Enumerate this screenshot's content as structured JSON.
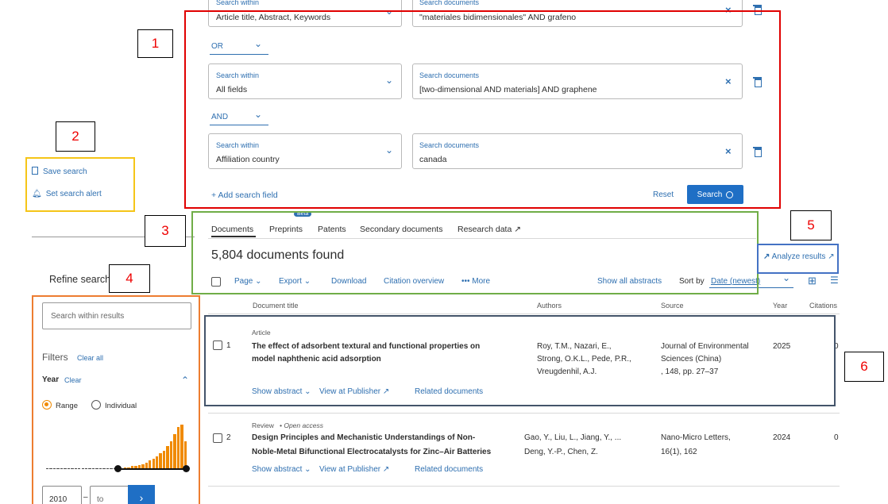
{
  "search_rows": [
    {
      "within_label": "Search within",
      "within_value": "Article title, Abstract, Keywords",
      "doc_label": "Search documents",
      "doc_value": "\"materiales bidimensionales\" AND grafeno"
    },
    {
      "within_label": "Search within",
      "within_value": "All fields",
      "doc_label": "Search documents",
      "doc_value": "[two-dimensional AND materials] AND graphene"
    },
    {
      "within_label": "Search within",
      "within_value": "Affiliation country",
      "doc_label": "Search documents",
      "doc_value": "canada"
    }
  ],
  "operators": [
    "OR",
    "AND"
  ],
  "add_field": "+ Add search field",
  "reset": "Reset",
  "search_button": "Search",
  "save_search": "Save search",
  "set_alert": "Set search alert",
  "tabs": [
    "Documents",
    "Preprints",
    "Patents",
    "Secondary documents",
    "Research data ↗"
  ],
  "tab_badge": "Beta",
  "results_count": "5,804 documents found",
  "analyze": "Analyze results ↗",
  "toolbar": {
    "page": "Page",
    "export": "Export",
    "download": "Download",
    "citation_overview": "Citation overview",
    "more": "••• More",
    "show_abstracts": "Show all abstracts",
    "sort_label": "Sort by",
    "sort_value": "Date (newest)"
  },
  "refine": {
    "title": "Refine search",
    "search_placeholder": "Search within results",
    "filters": "Filters",
    "clear_all": "Clear all",
    "year": "Year",
    "clear": "Clear",
    "range": "Range",
    "individual": "Individual",
    "from_year": "2010",
    "to_placeholder": "to",
    "dash": "–"
  },
  "year_histogram": [
    1,
    1,
    1,
    1,
    1,
    1,
    1,
    1,
    1,
    1,
    1,
    1,
    1,
    1,
    1,
    1,
    1,
    1,
    1,
    1,
    1,
    1,
    2,
    2,
    3,
    3,
    4,
    5,
    7,
    9,
    11,
    14,
    17,
    20,
    25,
    30,
    38,
    45,
    48,
    30
  ],
  "columns": [
    "Document title",
    "Authors",
    "Source",
    "Year",
    "Citations"
  ],
  "results": [
    {
      "num": "1",
      "type": "Article",
      "open_access": "",
      "title1": "The effect of adsorbent textural and functional properties on",
      "title2": "model naphthenic acid adsorption",
      "authors": [
        "Roy, T.M., Nazari, E.,",
        "Strong, O.K.L., Pede, P.R.,",
        "Vreugdenhil, A.J."
      ],
      "source": [
        "Journal of Environmental",
        "Sciences (China)",
        ", 148, pp. 27–37"
      ],
      "year": "2025",
      "citations": "0",
      "show_abstract": "Show abstract",
      "publisher": "View at Publisher ↗",
      "related": "Related documents"
    },
    {
      "num": "2",
      "type": "Review",
      "open_access": "Open access",
      "title1": "Design Principles and Mechanistic Understandings of Non-",
      "title2": "Noble-Metal Bifunctional Electrocatalysts for Zinc–Air Batteries",
      "authors": [
        "Gao, Y., Liu, L., Jiang, Y., ...",
        "Deng, Y.-P., Chen, Z."
      ],
      "source": [
        "Nano-Micro Letters,",
        "16(1), 162"
      ],
      "year": "2024",
      "citations": "0",
      "show_abstract": "Show abstract",
      "publisher": "View at Publisher ↗",
      "related": "Related documents"
    }
  ],
  "callouts": [
    "1",
    "2",
    "3",
    "4",
    "5",
    "6"
  ],
  "colors": {
    "accent": "#2e6fb0",
    "search_button": "#1f6fc5",
    "orange": "#f08a00",
    "box1": "#e00000",
    "box2": "#f5c518",
    "box3": "#70ad47",
    "box4": "#ed7d31",
    "box5": "#4472c4",
    "box6": "#44546a"
  }
}
